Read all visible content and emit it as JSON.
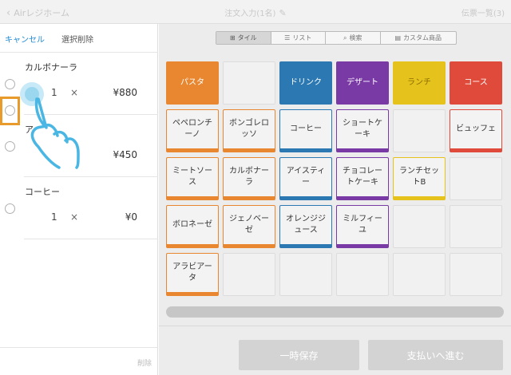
{
  "header": {
    "back_label": "Airレジホーム",
    "title": "注文入力(1名)",
    "right_label": "伝票一覧(3)"
  },
  "left": {
    "cancel_label": "キャンセル",
    "delete_selected_label": "選択削除",
    "delete_label": "削除",
    "times_symbol": "×",
    "items": [
      {
        "name": "カルボナーラ",
        "qty": "1",
        "price": "¥880"
      },
      {
        "name": "ア",
        "qty": "",
        "price": "¥450"
      },
      {
        "name": "コーヒー",
        "qty": "1",
        "price": "¥0"
      }
    ]
  },
  "tabs": [
    {
      "icon": "⊞",
      "label": "タイル",
      "active": true
    },
    {
      "icon": "☰",
      "label": "リスト",
      "active": false
    },
    {
      "icon": "⌕",
      "label": "検索",
      "active": false
    },
    {
      "icon": "▤",
      "label": "カスタム商品",
      "active": false
    }
  ],
  "colors": {
    "orange": "#e8872f",
    "blue": "#2c78b2",
    "purple": "#7a3aa6",
    "yellow": "#e6c21c",
    "red": "#e04a3a",
    "highlight": "#e89a2a",
    "gesture": "#4ab6e3"
  },
  "tiles": [
    {
      "label": "パスタ",
      "kind": "cat",
      "color": "orange"
    },
    {
      "label": "",
      "kind": "empty"
    },
    {
      "label": "ドリンク",
      "kind": "cat",
      "color": "blue"
    },
    {
      "label": "デザート",
      "kind": "cat",
      "color": "purple"
    },
    {
      "label": "ランチ",
      "kind": "cat",
      "color": "yellow",
      "dark": true
    },
    {
      "label": "コース",
      "kind": "cat",
      "color": "red"
    },
    {
      "label": "ペペロンチーノ",
      "kind": "item",
      "color": "orange"
    },
    {
      "label": "ボンゴレロッソ",
      "kind": "item",
      "color": "orange"
    },
    {
      "label": "コーヒー",
      "kind": "item",
      "color": "blue"
    },
    {
      "label": "ショートケーキ",
      "kind": "item",
      "color": "purple"
    },
    {
      "label": "",
      "kind": "empty"
    },
    {
      "label": "ビュッフェ",
      "kind": "item",
      "color": "red"
    },
    {
      "label": "ミートソース",
      "kind": "item",
      "color": "orange"
    },
    {
      "label": "カルボナーラ",
      "kind": "item",
      "color": "orange"
    },
    {
      "label": "アイスティー",
      "kind": "item",
      "color": "blue"
    },
    {
      "label": "チョコレートケーキ",
      "kind": "item",
      "color": "purple"
    },
    {
      "label": "ランチセットB",
      "kind": "item",
      "color": "yellow"
    },
    {
      "label": "",
      "kind": "empty"
    },
    {
      "label": "ボロネーゼ",
      "kind": "item",
      "color": "orange"
    },
    {
      "label": "ジェノベーゼ",
      "kind": "item",
      "color": "orange"
    },
    {
      "label": "オレンジジュース",
      "kind": "item",
      "color": "blue"
    },
    {
      "label": "ミルフィーユ",
      "kind": "item",
      "color": "purple"
    },
    {
      "label": "",
      "kind": "empty"
    },
    {
      "label": "",
      "kind": "empty"
    },
    {
      "label": "アラビアータ",
      "kind": "item",
      "color": "orange"
    },
    {
      "label": "",
      "kind": "empty"
    },
    {
      "label": "",
      "kind": "empty"
    },
    {
      "label": "",
      "kind": "empty"
    },
    {
      "label": "",
      "kind": "empty"
    },
    {
      "label": "",
      "kind": "empty"
    }
  ],
  "footer": {
    "save_label": "一時保存",
    "pay_label": "支払いへ進む"
  }
}
